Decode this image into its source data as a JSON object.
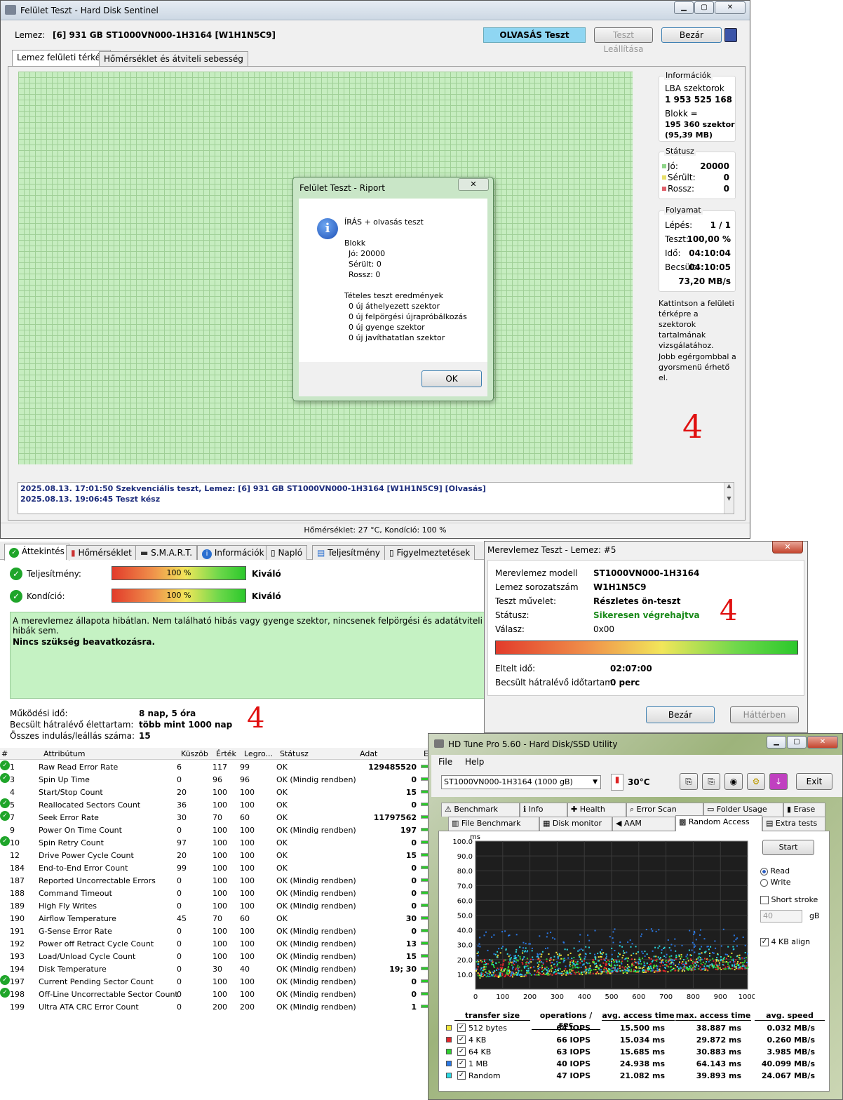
{
  "hds": {
    "title": "Felület Teszt - Hard Disk Sentinel",
    "disk_label": "Lemez:",
    "disk_value": "[6] 931 GB  ST1000VN000-1H3164 [W1H1N5C9]",
    "mode": "OLVASÁS Teszt",
    "stop": "Teszt Leállítása",
    "close": "Bezár",
    "tabs": [
      "Lemez felületi térkép",
      "Hőmérséklet és átviteli sebesség"
    ],
    "info": {
      "title": "Információk",
      "lba_label": "LBA szektorok",
      "lba_value": "1 953 525 168",
      "block_label": "Blokk =",
      "block_value": "195 360 szektor",
      "block_mb": "(95,39 MB)"
    },
    "status": {
      "title": "Státusz",
      "good_label": "Jó:",
      "good": "20000",
      "damaged_label": "Sérült:",
      "damaged": "0",
      "bad_label": "Rossz:",
      "bad": "0"
    },
    "progress": {
      "title": "Folyamat",
      "step_label": "Lépés:",
      "step": "1 / 1",
      "test_label": "Teszt:",
      "test": "100,00 %",
      "time_label": "Idő:",
      "time": "04:10:04",
      "est_label": "Becsült:",
      "est": "04:10:05",
      "speed": "73,20 MB/s"
    },
    "hint1": "Kattintson a felületi térképre a szektorok tartalmának vizsgálatához.",
    "hint2": "Jobb egérgombbal a gyorsmenü érhető el.",
    "log": [
      "2025.08.13.  17:01:50   Szekvenciális teszt, Lemez: [6] 931 GB  ST1000VN000-1H3164 [W1H1N5C9] [Olvasás]",
      "2025.08.13.  19:06:45   Teszt kész"
    ],
    "statusbar": "Hőmérséklet: 27  °C, Kondíció: 100 %"
  },
  "report": {
    "title": "Felület Teszt - Riport",
    "line1": "ÍRÁS + olvasás teszt",
    "blokk": "Blokk",
    "good": "Jó: 20000",
    "damaged": "Sérült: 0",
    "bad": "Rossz: 0",
    "items_title": "Tételes teszt eredmények",
    "items": [
      "0 új áthelyezett szektor",
      "0 új felpörgési újrapróbálkozás",
      "0 új gyenge szektor",
      "0 új javíthatatlan szektor"
    ],
    "ok": "OK"
  },
  "overview": {
    "tabs": [
      "Áttekintés",
      "Hőmérséklet",
      "S.M.A.R.T.",
      "Információk",
      "Napló",
      "Teljesítmény",
      "Figyelmeztetések"
    ],
    "perf_label": "Teljesítmény:",
    "perf_value": "100 %",
    "perf_rating": "Kiváló",
    "cond_label": "Kondíció:",
    "cond_value": "100 %",
    "cond_rating": "Kiváló",
    "message": "A merevlemez állapota hibátlan. Nem található hibás vagy gyenge szektor, nincsenek felpörgési és adatátviteli hibák sem.",
    "action": "Nincs szükség beavatkozásra.",
    "uptime_label": "Működési idő:",
    "uptime": "8 nap, 5 óra",
    "life_label": "Becsült hátralévő élettartam:",
    "life": "több mint 1000 nap",
    "starts_label": "Összes indulás/leállás száma:",
    "starts": "15"
  },
  "smart": {
    "headers": [
      "#",
      "Attribútum",
      "Küszöb",
      "Érték",
      "Legro...",
      "Státusz",
      "Adat",
      "E"
    ],
    "rows": [
      {
        "id": "1",
        "name": "Raw Read Error Rate",
        "th": "6",
        "val": "117",
        "worst": "99",
        "status": "OK",
        "data": "129485520",
        "ok": true
      },
      {
        "id": "3",
        "name": "Spin Up Time",
        "th": "0",
        "val": "96",
        "worst": "96",
        "status": "OK (Mindig rendben)",
        "data": "0",
        "ok": true
      },
      {
        "id": "4",
        "name": "Start/Stop Count",
        "th": "20",
        "val": "100",
        "worst": "100",
        "status": "OK",
        "data": "15",
        "ok": false
      },
      {
        "id": "5",
        "name": "Reallocated Sectors Count",
        "th": "36",
        "val": "100",
        "worst": "100",
        "status": "OK",
        "data": "0",
        "ok": true
      },
      {
        "id": "7",
        "name": "Seek Error Rate",
        "th": "30",
        "val": "70",
        "worst": "60",
        "status": "OK",
        "data": "11797562",
        "ok": true
      },
      {
        "id": "9",
        "name": "Power On Time Count",
        "th": "0",
        "val": "100",
        "worst": "100",
        "status": "OK (Mindig rendben)",
        "data": "197",
        "ok": false
      },
      {
        "id": "10",
        "name": "Spin Retry Count",
        "th": "97",
        "val": "100",
        "worst": "100",
        "status": "OK",
        "data": "0",
        "ok": true
      },
      {
        "id": "12",
        "name": "Drive Power Cycle Count",
        "th": "20",
        "val": "100",
        "worst": "100",
        "status": "OK",
        "data": "15",
        "ok": false
      },
      {
        "id": "184",
        "name": "End-to-End Error Count",
        "th": "99",
        "val": "100",
        "worst": "100",
        "status": "OK",
        "data": "0",
        "ok": false
      },
      {
        "id": "187",
        "name": "Reported Uncorrectable Errors",
        "th": "0",
        "val": "100",
        "worst": "100",
        "status": "OK (Mindig rendben)",
        "data": "0",
        "ok": false
      },
      {
        "id": "188",
        "name": "Command Timeout",
        "th": "0",
        "val": "100",
        "worst": "100",
        "status": "OK (Mindig rendben)",
        "data": "0",
        "ok": false
      },
      {
        "id": "189",
        "name": "High Fly Writes",
        "th": "0",
        "val": "100",
        "worst": "100",
        "status": "OK (Mindig rendben)",
        "data": "0",
        "ok": false
      },
      {
        "id": "190",
        "name": "Airflow Temperature",
        "th": "45",
        "val": "70",
        "worst": "60",
        "status": "OK",
        "data": "30",
        "ok": false
      },
      {
        "id": "191",
        "name": "G-Sense Error Rate",
        "th": "0",
        "val": "100",
        "worst": "100",
        "status": "OK (Mindig rendben)",
        "data": "0",
        "ok": false
      },
      {
        "id": "192",
        "name": "Power off Retract Cycle Count",
        "th": "0",
        "val": "100",
        "worst": "100",
        "status": "OK (Mindig rendben)",
        "data": "13",
        "ok": false
      },
      {
        "id": "193",
        "name": "Load/Unload Cycle Count",
        "th": "0",
        "val": "100",
        "worst": "100",
        "status": "OK (Mindig rendben)",
        "data": "15",
        "ok": false
      },
      {
        "id": "194",
        "name": "Disk Temperature",
        "th": "0",
        "val": "30",
        "worst": "40",
        "status": "OK (Mindig rendben)",
        "data": "19; 30",
        "ok": false
      },
      {
        "id": "197",
        "name": "Current Pending Sector Count",
        "th": "0",
        "val": "100",
        "worst": "100",
        "status": "OK (Mindig rendben)",
        "data": "0",
        "ok": true
      },
      {
        "id": "198",
        "name": "Off-Line Uncorrectable Sector Count",
        "th": "0",
        "val": "100",
        "worst": "100",
        "status": "OK (Mindig rendben)",
        "data": "0",
        "ok": true
      },
      {
        "id": "199",
        "name": "Ultra ATA CRC Error Count",
        "th": "0",
        "val": "200",
        "worst": "200",
        "status": "OK (Mindig rendben)",
        "data": "1",
        "ok": false
      }
    ]
  },
  "selftest": {
    "title": "Merevlemez Teszt - Lemez: #5",
    "model_label": "Merevlemez modell",
    "model": "ST1000VN000-1H3164",
    "serial_label": "Lemez sorozatszám",
    "serial": "W1H1N5C9",
    "op_label": "Teszt művelet:",
    "op": "Részletes ön-teszt",
    "status_label": "Státusz:",
    "status": "Sikeresen végrehajtva",
    "resp_label": "Válasz:",
    "resp": "0x00",
    "elapsed_label": "Eltelt idő:",
    "elapsed": "02:07:00",
    "remain_label": "Becsült hátralévő időtartam:",
    "remain": "0 perc",
    "close": "Bezár",
    "background": "Háttérben"
  },
  "hdtune": {
    "title": "HD Tune Pro 5.60 - Hard Disk/SSD Utility",
    "menu": [
      "File",
      "Help"
    ],
    "drive": "ST1000VN000-1H3164 (1000 gB)",
    "temp": "30°C",
    "exit": "Exit",
    "tabs_row1": [
      "Benchmark",
      "Info",
      "Health",
      "Error Scan",
      "Folder Usage",
      "Erase"
    ],
    "tabs_row2": [
      "File Benchmark",
      "Disk monitor",
      "AAM",
      "Random Access",
      "Extra tests"
    ],
    "start": "Start",
    "read": "Read",
    "write": "Write",
    "short_stroke": "Short stroke",
    "stroke_value": "40",
    "gb": "gB",
    "align": "4 KB align",
    "ms": "ms",
    "yticks": [
      "100.0",
      "90.0",
      "80.0",
      "70.0",
      "60.0",
      "50.0",
      "40.0",
      "30.0",
      "20.0",
      "10.0"
    ],
    "xticks": [
      "0",
      "100",
      "200",
      "300",
      "400",
      "500",
      "600",
      "700",
      "800",
      "900",
      "1000gB"
    ],
    "table_headers": [
      "transfer size",
      "operations / sec",
      "avg. access time",
      "max. access time",
      "avg. speed"
    ],
    "rows": [
      {
        "size": "512 bytes",
        "ops": "64 IOPS",
        "avg": "15.500 ms",
        "max": "38.887 ms",
        "speed": "0.032 MB/s",
        "color": "#f2e83a"
      },
      {
        "size": "4 KB",
        "ops": "66 IOPS",
        "avg": "15.034 ms",
        "max": "29.872 ms",
        "speed": "0.260 MB/s",
        "color": "#e2262b"
      },
      {
        "size": "64 KB",
        "ops": "63 IOPS",
        "avg": "15.685 ms",
        "max": "30.883 ms",
        "speed": "3.985 MB/s",
        "color": "#2fcf2f"
      },
      {
        "size": "1 MB",
        "ops": "40 IOPS",
        "avg": "24.938 ms",
        "max": "64.143 ms",
        "speed": "40.099 MB/s",
        "color": "#2a78e4"
      },
      {
        "size": "Random",
        "ops": "47 IOPS",
        "avg": "21.082 ms",
        "max": "39.893 ms",
        "speed": "24.067 MB/s",
        "color": "#2ad8e2"
      }
    ]
  },
  "annotations": {
    "mark": "4"
  }
}
